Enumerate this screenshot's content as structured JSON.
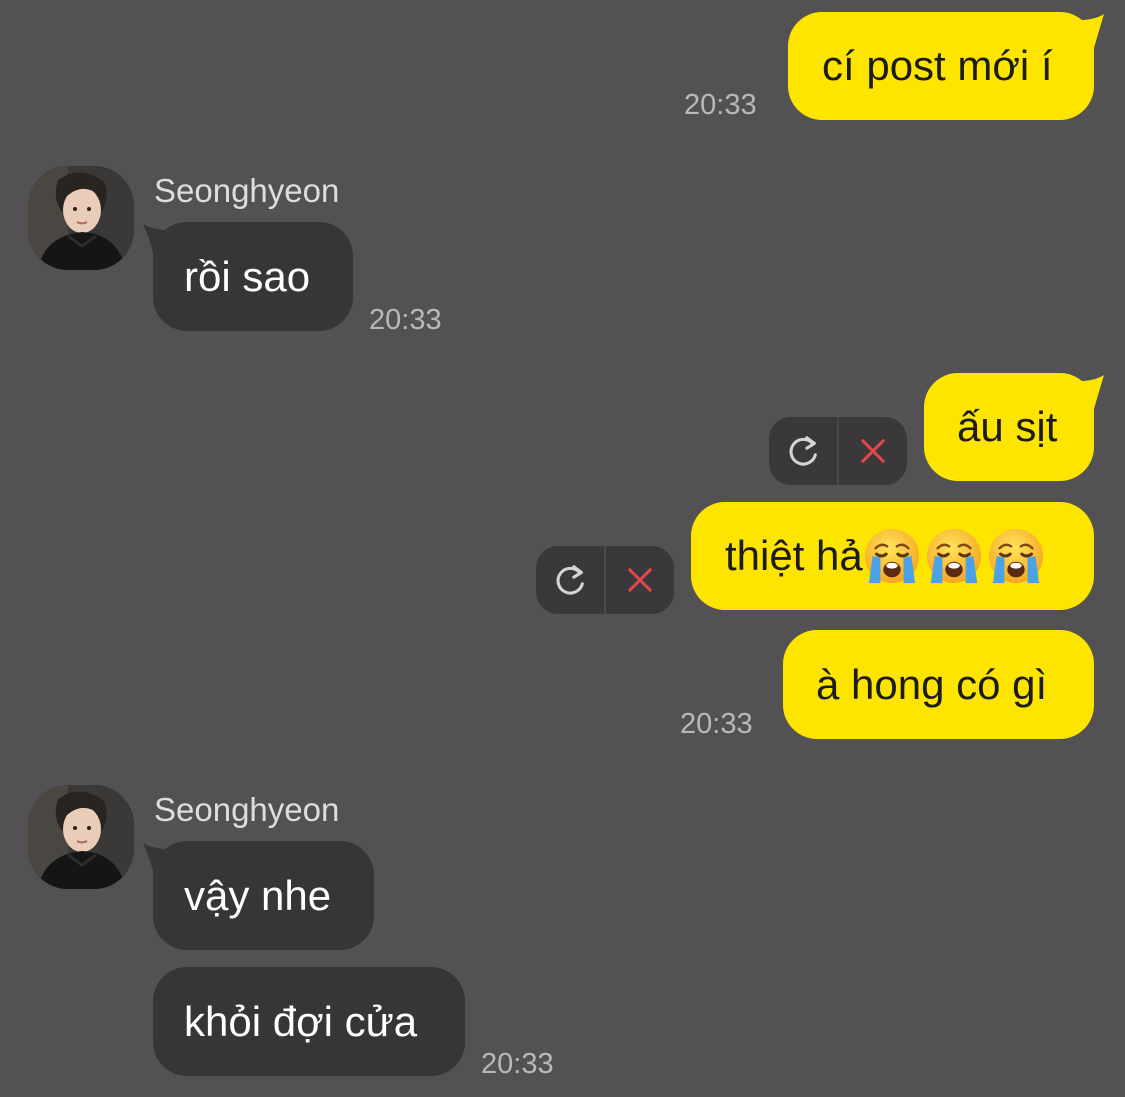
{
  "colors": {
    "background": "#535153",
    "sent_bubble": "#fee500",
    "received_bubble": "#373538",
    "fail_icon": "#e04848"
  },
  "messages": {
    "m1": {
      "text": "cí post mới í",
      "time": "20:33"
    },
    "m2": {
      "sender": "Seonghyeon",
      "text": "rồi sao",
      "time": "20:33"
    },
    "m3": {
      "text": "ấu sịt",
      "retry_icon": "retry-icon",
      "delete_icon": "close-icon"
    },
    "m4": {
      "text": "thiệt hả",
      "emoji": [
        "loudly-crying-face",
        "loudly-crying-face",
        "loudly-crying-face"
      ],
      "retry_icon": "retry-icon",
      "delete_icon": "close-icon"
    },
    "m5": {
      "text": "à hong có gì",
      "time": "20:33"
    },
    "m6": {
      "sender": "Seonghyeon",
      "text": "vậy nhe"
    },
    "m7": {
      "text": "khỏi đợi cửa",
      "time": "20:33"
    }
  }
}
